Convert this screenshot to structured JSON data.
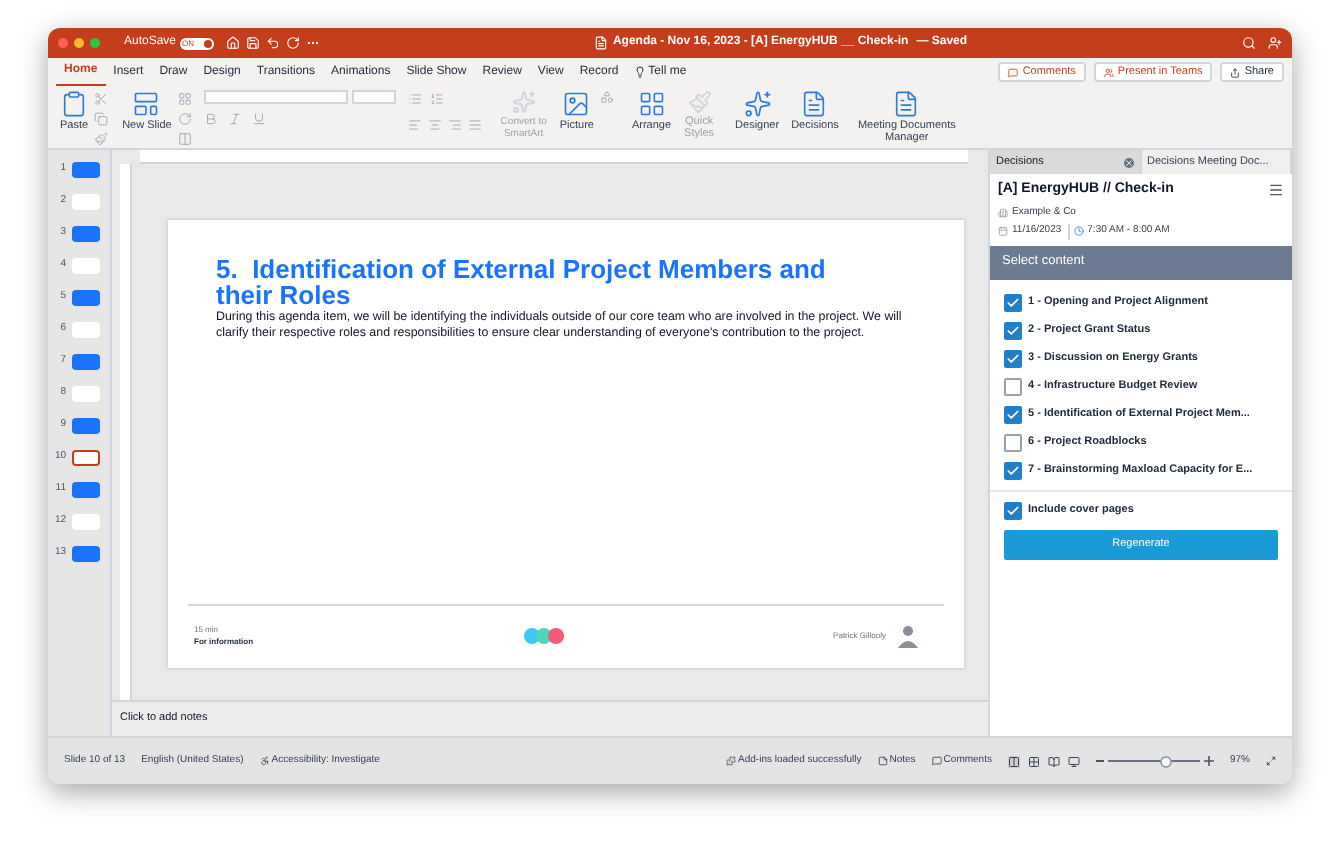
{
  "title_bar": {
    "autosave_label": "AutoSave",
    "autosave_toggle": {
      "label": "ON",
      "on": true
    },
    "title": "Agenda - Nov 16, 2023 - [A] EnergyHUB __ Check-in",
    "saved": "— Saved"
  },
  "tabs": [
    {
      "label": "Home",
      "selected": true
    },
    {
      "label": "Insert",
      "selected": false
    },
    {
      "label": "Draw",
      "selected": false
    },
    {
      "label": "Design",
      "selected": false
    },
    {
      "label": "Transitions",
      "selected": false
    },
    {
      "label": "Animations",
      "selected": false
    },
    {
      "label": "Slide Show",
      "selected": false
    },
    {
      "label": "Review",
      "selected": false
    },
    {
      "label": "View",
      "selected": false
    },
    {
      "label": "Record",
      "selected": false
    },
    {
      "label": "Tell me",
      "selected": false
    }
  ],
  "header_buttons": [
    "Comments",
    "Present in Teams",
    "Share"
  ],
  "ribbon": {
    "paste": "Paste",
    "new_slide": "New Slide",
    "convert": "Convert to SmartArt",
    "picture": "Picture",
    "arrange": "Arrange",
    "quick_styles": "Quick Styles",
    "designer": "Designer",
    "decisions": "Decisions",
    "meeting_docs": "Meeting Documents Manager"
  },
  "thumbnails": [
    {
      "number": "1",
      "color": "#1a73ff",
      "selected": false
    },
    {
      "number": "2",
      "color": "#ffffff",
      "selected": false
    },
    {
      "number": "3",
      "color": "#1a73ff",
      "selected": false
    },
    {
      "number": "4",
      "color": "#ffffff",
      "selected": false
    },
    {
      "number": "5",
      "color": "#1a73ff",
      "selected": false
    },
    {
      "number": "6",
      "color": "#ffffff",
      "selected": false
    },
    {
      "number": "7",
      "color": "#1a73ff",
      "selected": false
    },
    {
      "number": "8",
      "color": "#ffffff",
      "selected": false
    },
    {
      "number": "9",
      "color": "#1a73ff",
      "selected": false
    },
    {
      "number": "10",
      "color": "#ffffff",
      "selected": true
    },
    {
      "number": "11",
      "color": "#1a73ff",
      "selected": false
    },
    {
      "number": "12",
      "color": "#ffffff",
      "selected": false
    },
    {
      "number": "13",
      "color": "#1a73ff",
      "selected": false
    }
  ],
  "slide": {
    "title": "5.  Identification of External Project Members and their Roles",
    "body": "During this agenda item, we will be identifying the individuals outside of our core team who are involved in the project. We will clarify their respective roles and responsibilities to ensure clear understanding of everyone's contribution to the project.",
    "duration": "15 min",
    "type": "For information",
    "dots": [
      {
        "color": "#40c8f4"
      },
      {
        "color": "#4dd9b8"
      },
      {
        "color": "#f25c7a"
      }
    ],
    "presenter": "Patrick Gillooly"
  },
  "notes_placeholder": "Click to add notes",
  "panel": {
    "tabs": [
      {
        "label": "Decisions",
        "selected": true
      },
      {
        "label": "Decisions Meeting Doc...",
        "selected": false
      }
    ],
    "meeting_title": "[A] EnergyHUB // Check-in",
    "organization": "Example & Co",
    "date": "11/16/2023",
    "time": "7:30 AM - 8:00 AM",
    "section_title": "Select content",
    "items": [
      {
        "label": "1 - Opening and Project Alignment",
        "checked": true
      },
      {
        "label": "2 - Project Grant Status",
        "checked": true
      },
      {
        "label": "3 - Discussion on Energy Grants",
        "checked": true
      },
      {
        "label": "4 - Infrastructure Budget Review",
        "checked": false
      },
      {
        "label": "5 - Identification of External Project Mem...",
        "checked": true
      },
      {
        "label": "6 - Project Roadblocks",
        "checked": false
      },
      {
        "label": "7 - Brainstorming Maxload Capacity for E...",
        "checked": true
      }
    ],
    "cover_pages": {
      "label": "Include cover pages",
      "checked": true
    },
    "button": "Regenerate"
  },
  "status_bar": {
    "slide": "Slide 10 of 13",
    "language": "English (United States)",
    "accessibility": "Accessibility: Investigate",
    "addins": "Add-ins loaded successfully",
    "notes": "Notes",
    "comments": "Comments",
    "zoom": {
      "level": 0.62,
      "reading": "97%"
    }
  }
}
